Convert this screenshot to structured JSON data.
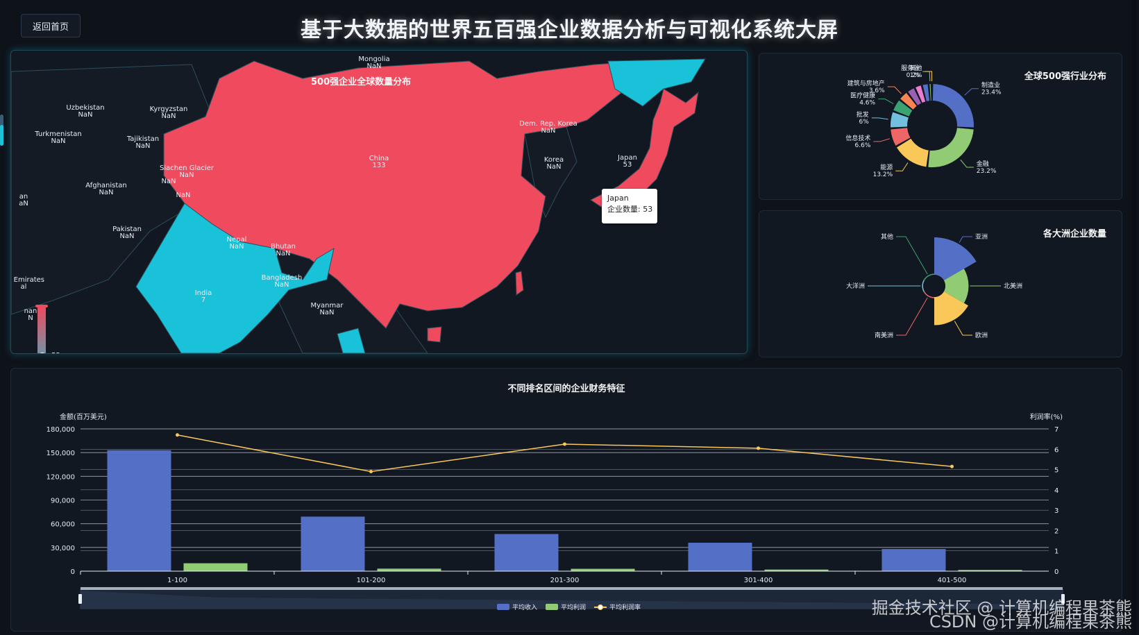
{
  "header": {
    "back_label": "返回首页",
    "title": "基于大数据的世界五百强企业数据分析与可视化系统大屏"
  },
  "map": {
    "title": "500强企业全球数量分布",
    "colors": {
      "high": "#f04a5e",
      "mid": "#19c2d8",
      "none": "#151b25",
      "border": "#2c4e5a"
    },
    "labels": [
      {
        "name": "Mongolia",
        "value": "NaN"
      },
      {
        "name": "Uzbekistan",
        "value": "NaN"
      },
      {
        "name": "Kyrgyzstan",
        "value": "NaN"
      },
      {
        "name": "Turkmenistan",
        "value": "NaN"
      },
      {
        "name": "Tajikistan",
        "value": "NaN"
      },
      {
        "name": "Afghanistan",
        "value": "NaN"
      },
      {
        "name": "Siachen Glacier",
        "value": "NaN"
      },
      {
        "name": "",
        "value": "NaN"
      },
      {
        "name": "",
        "value": "NaN"
      },
      {
        "name": "Pakistan",
        "value": "NaN"
      },
      {
        "name": "Nepal",
        "value": "NaN"
      },
      {
        "name": "Bhutan",
        "value": "NaN"
      },
      {
        "name": "Bangladesh",
        "value": "NaN"
      },
      {
        "name": "India",
        "value": "7"
      },
      {
        "name": "Myanmar",
        "value": "NaN"
      },
      {
        "name": "China",
        "value": "133"
      },
      {
        "name": "Dem. Rep. Korea",
        "value": "NaN"
      },
      {
        "name": "Korea",
        "value": "NaN"
      },
      {
        "name": "Japan",
        "value": "53"
      },
      {
        "name": "an",
        "value": "aN"
      },
      {
        "name": "ab Emirates",
        "value": "al"
      },
      {
        "name": "nan",
        "value": "N"
      }
    ],
    "visual_map": {
      "max": "133",
      "pointer_value": "53"
    },
    "tooltip": {
      "name": "Japan",
      "label": "企业数量",
      "value": "53"
    }
  },
  "industry": {
    "title": "全球500强行业分布",
    "chart_data": {
      "type": "pie",
      "variant": "donut",
      "slices": [
        {
          "name": "制造业",
          "value": 23.4,
          "label": "23.4%",
          "color": "#5470c6"
        },
        {
          "name": "金融",
          "value": 23.2,
          "label": "23.2%",
          "color": "#91cc75"
        },
        {
          "name": "能源",
          "value": 13.2,
          "label": "13.2%",
          "color": "#fac858"
        },
        {
          "name": "信息技术",
          "value": 6.6,
          "label": "6.6%",
          "color": "#ee6666"
        },
        {
          "name": "批发",
          "value": 6,
          "label": "6%",
          "color": "#73c0de"
        },
        {
          "name": "医疗健康",
          "value": 4.6,
          "label": "4.6%",
          "color": "#3ba272"
        },
        {
          "name": "建筑与房地产",
          "value": 3.6,
          "label": "3.6%",
          "color": "#fc8452"
        },
        {
          "name": "",
          "value": 3.0,
          "label": "",
          "color": "#9a60b4"
        },
        {
          "name": "",
          "value": 2.6,
          "label": "",
          "color": "#ea7ccc"
        },
        {
          "name": "",
          "value": 2.4,
          "label": "",
          "color": "#5470c6"
        },
        {
          "name": "服务业",
          "value": 1,
          "label": "1%",
          "color": "#91cc75"
        },
        {
          "name": "其他",
          "value": 0.2,
          "label": "0.2%",
          "color": "#fac858"
        }
      ]
    }
  },
  "continent": {
    "title": "各大洲企业数量",
    "chart_data": {
      "type": "pie",
      "variant": "rose",
      "slices": [
        {
          "name": "亚洲",
          "value": 100,
          "color": "#5470c6"
        },
        {
          "name": "北美洲",
          "value": 62,
          "color": "#91cc75"
        },
        {
          "name": "欧洲",
          "value": 75,
          "color": "#fac858"
        },
        {
          "name": "南美洲",
          "value": 3,
          "color": "#ee6666"
        },
        {
          "name": "大洋洲",
          "value": 3,
          "color": "#73c0de"
        },
        {
          "name": "其他",
          "value": 3,
          "color": "#3ba272"
        }
      ]
    }
  },
  "finance": {
    "title": "不同排名区间的企业财务特征",
    "chart_data": {
      "type": "bar",
      "categories": [
        "1-100",
        "101-200",
        "201-300",
        "301-400",
        "401-500"
      ],
      "series": [
        {
          "name": "平均收入",
          "kind": "bar",
          "axis": "left",
          "color": "#5470c6",
          "values": [
            153000,
            69000,
            47000,
            36000,
            28000
          ]
        },
        {
          "name": "平均利润",
          "kind": "bar",
          "axis": "left",
          "color": "#91cc75",
          "values": [
            10000,
            3200,
            3000,
            2000,
            1500
          ]
        },
        {
          "name": "平均利润率",
          "kind": "line",
          "axis": "right",
          "color": "#fac858",
          "values": [
            6.7,
            4.9,
            6.25,
            6.05,
            5.15
          ]
        }
      ],
      "ylabel_left": "金额(百万美元)",
      "ylabel_right": "利润率(%)",
      "ylim_left": [
        0,
        180000
      ],
      "ylim_right": [
        0,
        7
      ],
      "yticks_left": [
        "0",
        "30,000",
        "60,000",
        "90,000",
        "120,000",
        "150,000",
        "180,000"
      ],
      "yticks_right": [
        "0",
        "1",
        "2",
        "3",
        "4",
        "5",
        "6",
        "7"
      ],
      "legend_position": "bottom"
    }
  },
  "watermark": {
    "line1": "掘金技术社区 @ 计算机编程果茶熊",
    "line2": "CSDN @计算机编程果茶熊"
  }
}
